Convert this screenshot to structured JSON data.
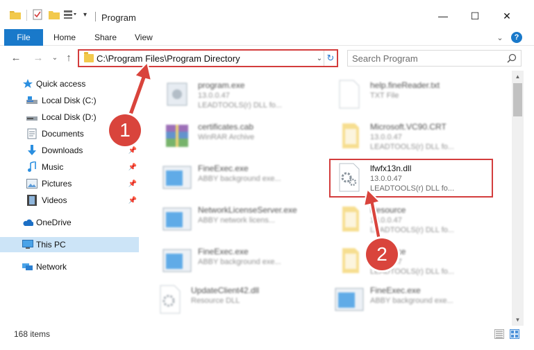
{
  "window": {
    "title": "Program",
    "minimize_glyph": "—",
    "maximize_glyph": "☐",
    "close_glyph": "✕"
  },
  "ribbon": {
    "tabs": [
      "File",
      "Home",
      "Share",
      "View"
    ],
    "expand_glyph": "⌄",
    "help_glyph": "?"
  },
  "nav": {
    "back_glyph": "←",
    "forward_glyph": "→",
    "recent_glyph": "⌄",
    "up_glyph": "↑"
  },
  "address": {
    "path": "C:\\Program Files\\Program Directory",
    "dropdown_glyph": "⌄",
    "refresh_glyph": "↻"
  },
  "search": {
    "placeholder": "Search Program"
  },
  "sidebar": {
    "items": [
      {
        "label": "Quick access",
        "icon": "star-icon"
      },
      {
        "label": "Local Disk (C:)",
        "icon": "drive-icon"
      },
      {
        "label": "Local Disk (D:)",
        "icon": "drive-icon"
      },
      {
        "label": "Documents",
        "icon": "documents-icon"
      },
      {
        "label": "Downloads",
        "icon": "download-icon"
      },
      {
        "label": "Music",
        "icon": "music-icon"
      },
      {
        "label": "Pictures",
        "icon": "pictures-icon"
      },
      {
        "label": "Videos",
        "icon": "videos-icon"
      },
      {
        "label": "OneDrive",
        "icon": "cloud-icon"
      },
      {
        "label": "This PC",
        "icon": "computer-icon"
      },
      {
        "label": "Network",
        "icon": "network-icon"
      }
    ]
  },
  "files": [
    {
      "name": "program.exe",
      "meta1": "13.0.0.47",
      "meta2": "LEADTOOLS(r) DLL fo...",
      "icon": "exe-icon"
    },
    {
      "name": "help.fineReader.txt",
      "meta1": "TXT File",
      "meta2": "",
      "icon": "text-file-icon"
    },
    {
      "name": "certificates.cab",
      "meta1": "WinRAR Archive",
      "meta2": "",
      "icon": "archive-icon"
    },
    {
      "name": "Microsoft.VC90.CRT",
      "meta1": "13.0.0.47",
      "meta2": "LEADTOOLS(r) DLL fo...",
      "icon": "folder-icon"
    },
    {
      "name": "FineExec.exe",
      "meta1": "ABBY background exe...",
      "meta2": "",
      "icon": "app-window-icon"
    },
    {
      "name": "lfwfx13n.dll",
      "meta1": "13.0.0.47",
      "meta2": "LEADTOOLS(r) DLL fo...",
      "icon": "dll-gear-icon"
    },
    {
      "name": "NetworkLicenseServer.exe",
      "meta1": "ABBY network licens...",
      "meta2": "",
      "icon": "app-window-icon"
    },
    {
      "name": "Resource",
      "meta1": "13.0.0.47",
      "meta2": "LEADTOOLS(r) DLL fo...",
      "icon": "folder-icon"
    },
    {
      "name": "FineExec.exe",
      "meta1": "ABBY background exe...",
      "meta2": "",
      "icon": "app-window-icon"
    },
    {
      "name": "Resource",
      "meta1": "13.0.0.47",
      "meta2": "LEADTOOLS(r) DLL fo...",
      "icon": "folder-icon"
    },
    {
      "name": "UpdateClient42.dll",
      "meta1": "Resource DLL",
      "meta2": "",
      "icon": "dll-gear-icon"
    },
    {
      "name": "FineExec.exe",
      "meta1": "ABBY background exe...",
      "meta2": "",
      "icon": "app-window-icon"
    }
  ],
  "status": {
    "item_count": "168 items"
  },
  "annotations": {
    "step1": "1",
    "step2": "2",
    "color": "#d9443c"
  },
  "colors": {
    "accent": "#1979ca",
    "highlight_border": "#d33c3c",
    "selected_bg": "#cce4f7"
  }
}
